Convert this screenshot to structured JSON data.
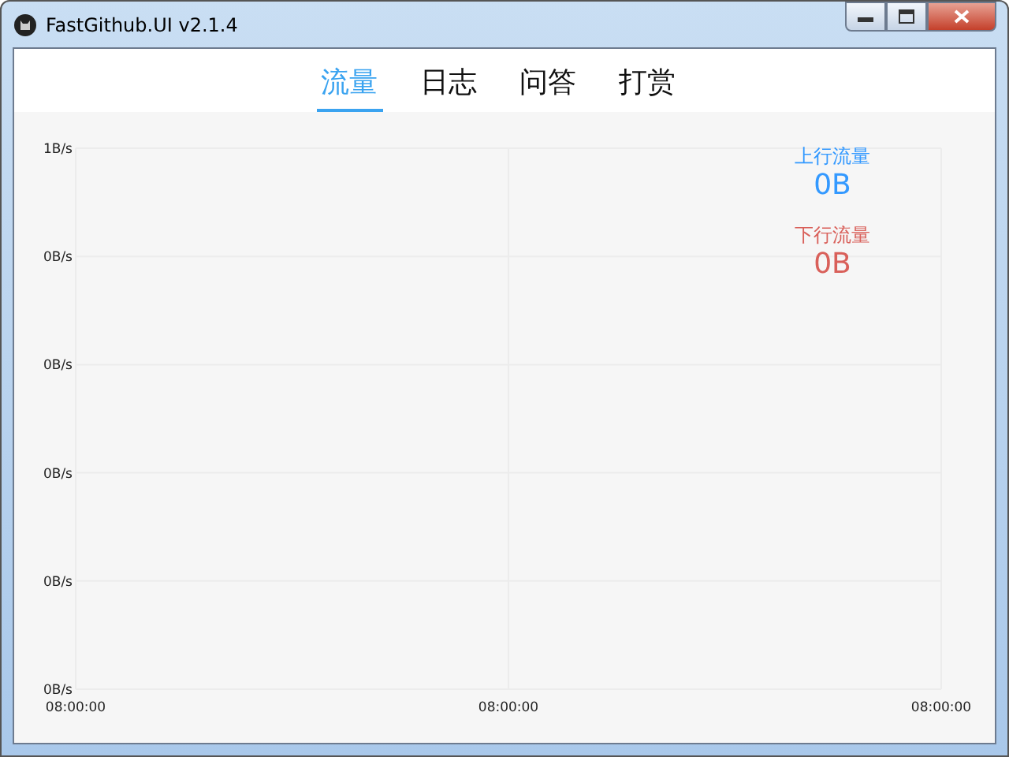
{
  "window": {
    "title": "FastGithub.UI v2.1.4"
  },
  "tabs": [
    {
      "label": "流量",
      "selected": true
    },
    {
      "label": "日志",
      "selected": false
    },
    {
      "label": "问答",
      "selected": false
    },
    {
      "label": "打赏",
      "selected": false
    }
  ],
  "legend": [
    {
      "label": "上行流量",
      "value": "0B",
      "color": "#3399ff"
    },
    {
      "label": "下行流量",
      "value": "0B",
      "color": "#d9605a"
    }
  ],
  "chart": {
    "chart_data": {
      "type": "line",
      "grid": true,
      "categories": [
        "08:00:00",
        "08:00:00",
        "08:00:00"
      ],
      "ylim": [
        0,
        1
      ],
      "yticks": [
        {
          "value": 1,
          "label": "1B/s"
        },
        {
          "value": 0.8,
          "label": "0B/s"
        },
        {
          "value": 0.6,
          "label": "0B/s"
        },
        {
          "value": 0.4,
          "label": "0B/s"
        },
        {
          "value": 0.2,
          "label": "0B/s"
        },
        {
          "value": 0,
          "label": "0B/s"
        }
      ]
    }
  }
}
